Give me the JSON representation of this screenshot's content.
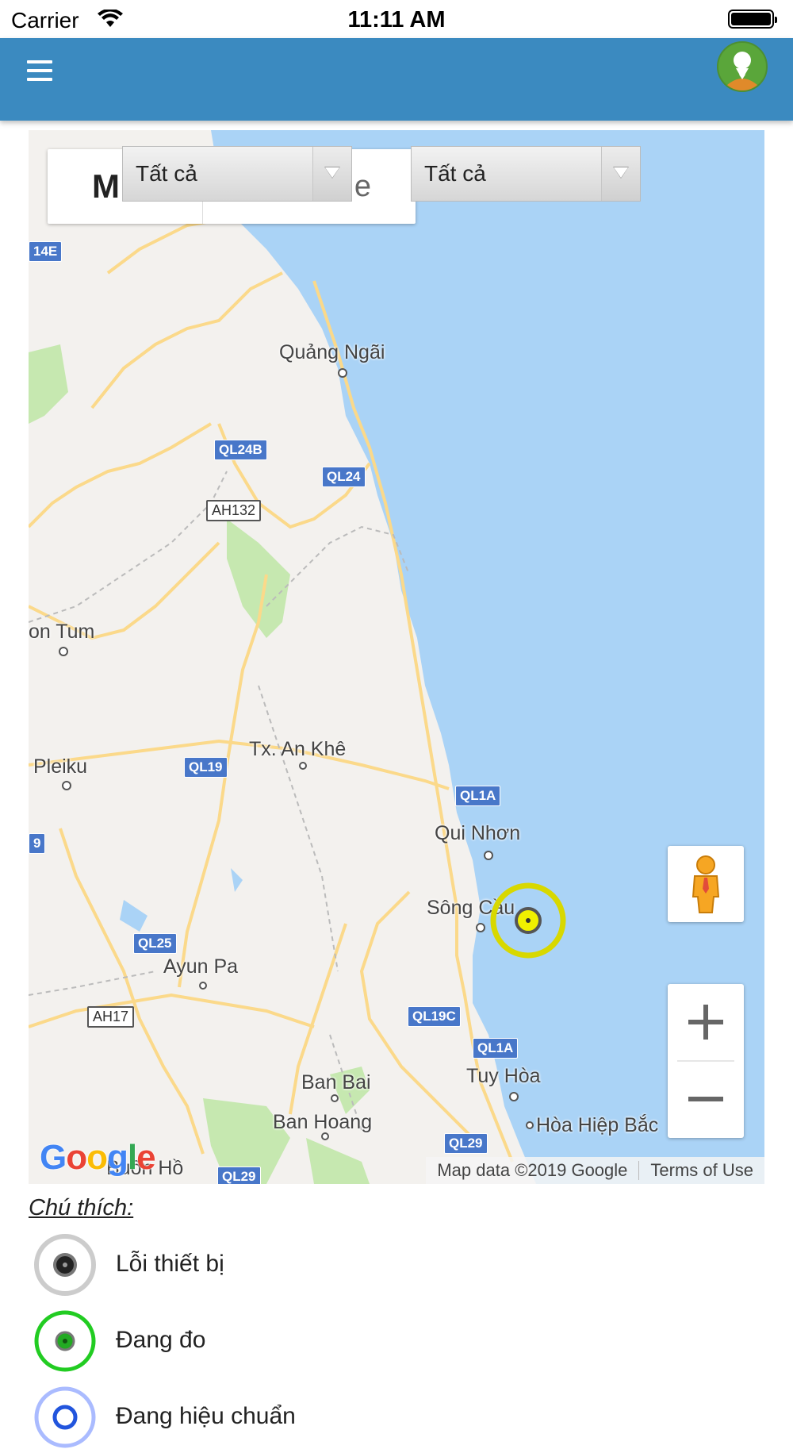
{
  "status_bar": {
    "carrier": "Carrier",
    "time": "11:11 AM"
  },
  "header": {
    "menu_icon": "hamburger-icon",
    "avatar_icon": "user-avatar-icon",
    "accent_color": "#3b8ac0"
  },
  "map": {
    "map_type_left": "M",
    "map_type_right": "e",
    "filter_1": "Tất cả",
    "filter_2": "Tất cả",
    "places": {
      "quang_ngai": "Quảng Ngãi",
      "kon_tum": "on Tum",
      "pleiku": "Pleiku",
      "an_khe": "Tx. An Khê",
      "qui_nhon": "Qui Nhơn",
      "song_cau": "Sông Cầu",
      "ayun_pa": "Ayun Pa",
      "tuy_hoa": "Tuy Hòa",
      "ban_bai": "Ban Bai",
      "ban_hoang": "Ban Hoang",
      "hoa_hiep_bac": "Hòa Hiệp Bắc",
      "buon_ho": "Buôn Hồ"
    },
    "roads": {
      "r14e": "14E",
      "ql24b": "QL24B",
      "ql24": "QL24",
      "ah132": "AH132",
      "ql19": "QL19",
      "r9": "9",
      "ql1a_marker": "QL1A",
      "ql25": "QL25",
      "ah17": "AH17",
      "ql19c": "QL19C",
      "ql1a": "QL1A",
      "ql29": "QL29",
      "ql29b": "QL29"
    },
    "google_logo": "Google",
    "attribution": "Map data ©2019 Google",
    "terms": "Terms of Use",
    "station_color": "#e6e600"
  },
  "legend": {
    "title": "Chú thích:",
    "items": [
      {
        "label": "Lỗi thiết bị",
        "color": "#222222",
        "ring": "#cccccc"
      },
      {
        "label": "Đang đo",
        "color": "#22aa22",
        "ring": "#22cc22"
      },
      {
        "label": "Đang hiệu chuẩn",
        "color": "#2255dd",
        "ring": "#aabbff"
      }
    ]
  }
}
